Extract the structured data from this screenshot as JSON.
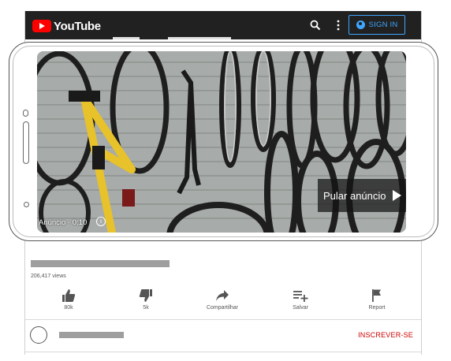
{
  "header": {
    "logo_text": "YouTube",
    "sign_in_label": "SIGN IN",
    "icons": [
      "search-icon",
      "more-vert-icon",
      "account-circle-icon"
    ]
  },
  "video": {
    "ad_label": "Anúncio · 0:10",
    "skip_label": "Pular anúncio"
  },
  "meta": {
    "views": "206,417 views"
  },
  "actions": [
    {
      "icon": "thumbs-up-icon",
      "label": "80k"
    },
    {
      "icon": "thumbs-down-icon",
      "label": "5k"
    },
    {
      "icon": "share-icon",
      "label": "Compartilhar"
    },
    {
      "icon": "playlist-add-icon",
      "label": "Salvar"
    },
    {
      "icon": "flag-icon",
      "label": "Report"
    }
  ],
  "channel": {
    "subscribe_label": "INSCREVER-SE"
  },
  "colors": {
    "header_bg": "#212121",
    "brand_red": "#ff0000",
    "sign_in_blue": "#3ea6ff",
    "subscribe_red": "#cc0000"
  }
}
